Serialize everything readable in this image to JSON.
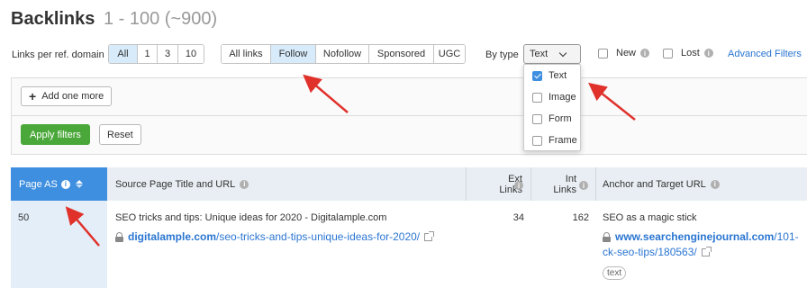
{
  "header": {
    "title": "Backlinks",
    "range": "1 - 100 (~900)"
  },
  "links_per_domain": {
    "label": "Links per ref. domain",
    "options": [
      "All",
      "1",
      "3",
      "10"
    ],
    "selected": "All"
  },
  "link_type": {
    "options": [
      "All links",
      "Follow",
      "Nofollow",
      "Sponsored",
      "UGC"
    ],
    "selected": "Follow"
  },
  "by_type": {
    "label": "By type",
    "value": "Text",
    "options": [
      {
        "label": "Text",
        "checked": true
      },
      {
        "label": "Image",
        "checked": false
      },
      {
        "label": "Form",
        "checked": false
      },
      {
        "label": "Frame",
        "checked": false
      }
    ]
  },
  "new_filter": {
    "label": "New"
  },
  "lost_filter": {
    "label": "Lost"
  },
  "advanced_filters": "Advanced Filters",
  "filter_panel": {
    "add_label": "Add one more",
    "apply_label": "Apply filters",
    "reset_label": "Reset"
  },
  "table": {
    "columns": {
      "page_as": "Page AS",
      "source": "Source Page Title and URL",
      "ext_links_1": "Ext",
      "ext_links_2": "Links",
      "int_links_1": "Int",
      "int_links_2": "Links",
      "anchor": "Anchor and Target URL"
    },
    "rows": [
      {
        "page_as": "50",
        "source_title": "SEO tricks and tips: Unique ideas for 2020 - Digitalample.com",
        "source_domain": "digitalample.com",
        "source_path": "/seo-tricks-and-tips-unique-ideas-for-2020/",
        "ext_links": "34",
        "int_links": "162",
        "anchor": "SEO as a magic stick",
        "target_domain": "www.searchenginejournal.com",
        "target_path_1": "/101-",
        "target_path_2": "ck-seo-tips/180563/",
        "tag": "text"
      }
    ]
  },
  "colors": {
    "accent": "#3f8fe0",
    "apply": "#4aa83a",
    "link": "#2a75d1",
    "arrow": "#e0312b",
    "active_segment": "#d7ebfb"
  }
}
